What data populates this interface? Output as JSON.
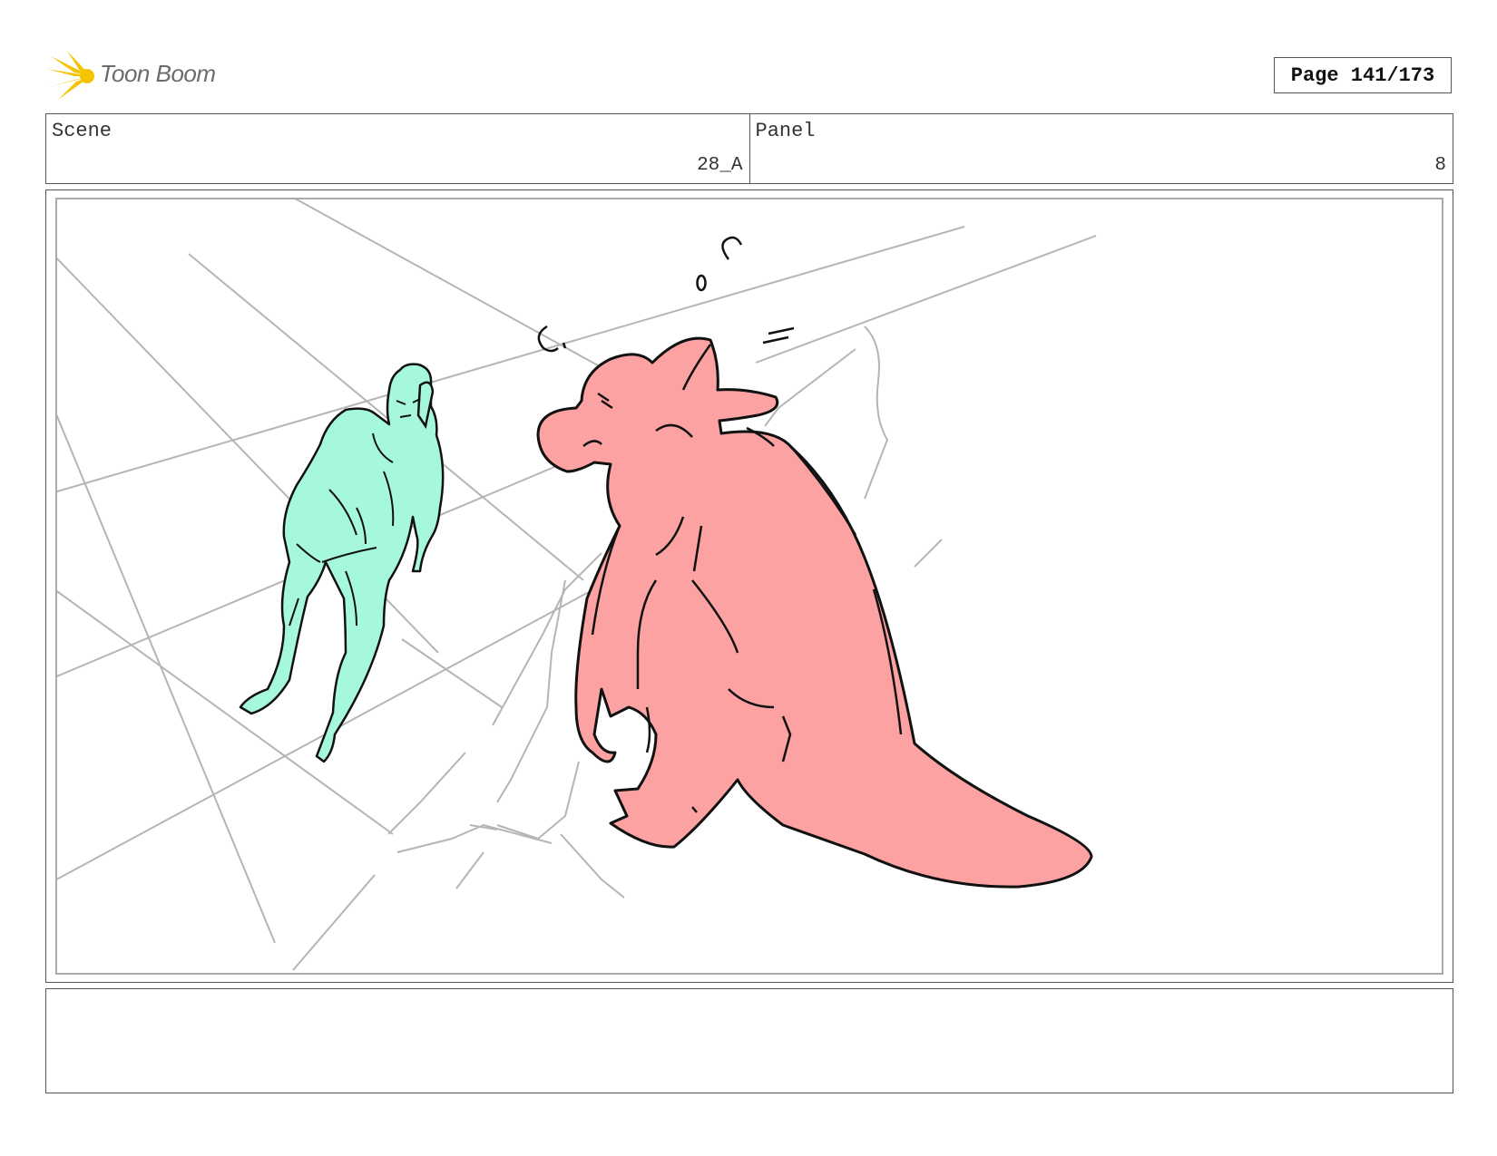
{
  "header": {
    "logo_text": "Toon Boom",
    "logo_color": "#f5c400",
    "page_label": "Page 141/173"
  },
  "info": {
    "scene_label": "Scene",
    "scene_value": "28_A",
    "panel_label": "Panel",
    "panel_value": "8"
  },
  "panel": {
    "description": "",
    "colors": {
      "green_character": "#a6f8dc",
      "pink_character": "#fda2a2",
      "guide_lines": "#b5b5b5",
      "ink": "#111111"
    }
  },
  "notes": {
    "text": ""
  }
}
